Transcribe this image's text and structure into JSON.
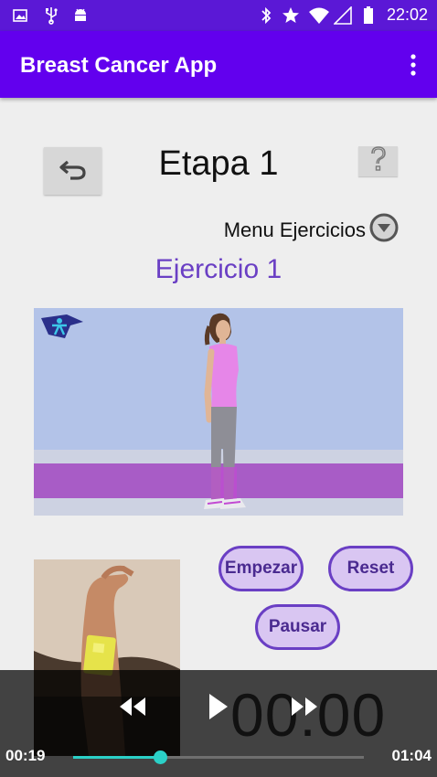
{
  "status_bar": {
    "time": "22:02",
    "left_icons": [
      "image-icon",
      "usb-icon",
      "android-icon"
    ],
    "right_icons": [
      "bluetooth-icon",
      "star-icon",
      "wifi-icon",
      "signal-icon",
      "battery-icon"
    ]
  },
  "app_bar": {
    "title": "Breast Cancer App",
    "menu_icon": "more-vert-icon",
    "color": "#6200ee"
  },
  "header": {
    "back_icon": "undo-arrow-icon",
    "stage_title": "Etapa 1",
    "help_icon": "question-mark-icon"
  },
  "menu": {
    "label": "Menu Ejercicios",
    "icon": "dropdown-circle-icon"
  },
  "exercise": {
    "title": "Ejercicio 1"
  },
  "buttons": {
    "start": "Empezar",
    "reset": "Reset",
    "pause": "Pausar"
  },
  "timer": {
    "display": "00:00"
  },
  "media_controls": {
    "elapsed": "00:19",
    "duration": "01:04",
    "progress": 0.3,
    "accent": "#2bd0c7"
  }
}
